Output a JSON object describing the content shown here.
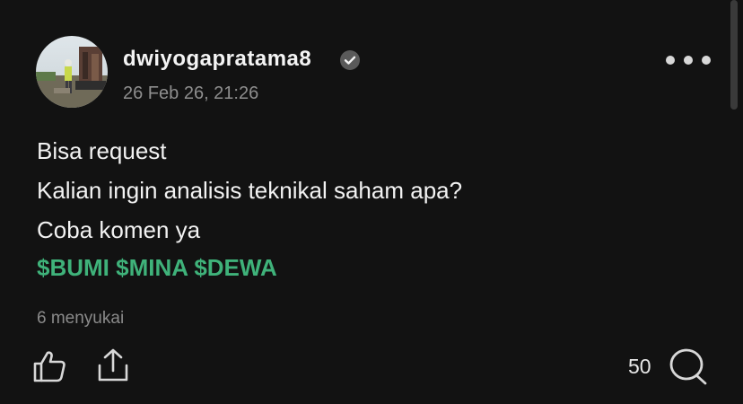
{
  "post": {
    "author": {
      "username": "dwiyogapratama8",
      "verified": true,
      "avatar_icon": "user-photo-avatar"
    },
    "timestamp": "26 Feb 26, 21:26",
    "body_lines": [
      "Bisa request",
      "Kalian ingin analisis teknikal saham apa?",
      "Coba komen ya"
    ],
    "tickers": [
      "$BUMI",
      "$MINA",
      "$DEWA"
    ],
    "likes_text": "6 menyukai",
    "comment_count": "50",
    "icons": {
      "verified": "verified-check-icon",
      "more": "more-options-icon",
      "like": "thumbs-up-icon",
      "share": "share-icon",
      "comment": "comment-bubble-icon"
    },
    "colors": {
      "background": "#121212",
      "ticker": "#3fb27a",
      "muted": "#8e8e8e"
    }
  }
}
